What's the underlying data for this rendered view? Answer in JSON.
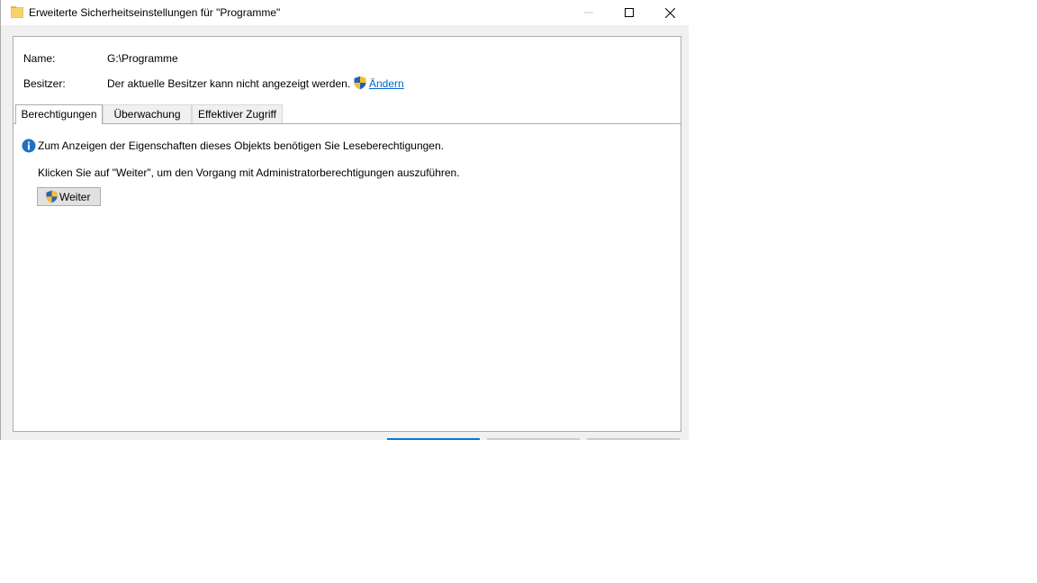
{
  "window": {
    "title": "Erweiterte Sicherheitseinstellungen für \"Programme\"",
    "icon": "folder-icon"
  },
  "fields": {
    "name_label": "Name:",
    "name_value": "G:\\Programme",
    "owner_label": "Besitzer:",
    "owner_value": "Der aktuelle Besitzer kann nicht angezeigt werden.",
    "owner_change_link": "Ändern"
  },
  "tabs": [
    {
      "label": "Berechtigungen",
      "active": true
    },
    {
      "label": "Überwachung",
      "active": false
    },
    {
      "label": "Effektiver Zugriff",
      "active": false
    }
  ],
  "content": {
    "info_message": "Zum Anzeigen der Eigenschaften dieses Objekts benötigen Sie Leseberechtigungen.",
    "hint_message": "Klicken Sie auf \"Weiter\", um den Vorgang mit Administratorberechtigungen auszuführen.",
    "continue_button": "Weiter"
  },
  "colors": {
    "accent": "#0078d7",
    "link": "#0066cc",
    "info_icon": "#1f6fc5"
  }
}
